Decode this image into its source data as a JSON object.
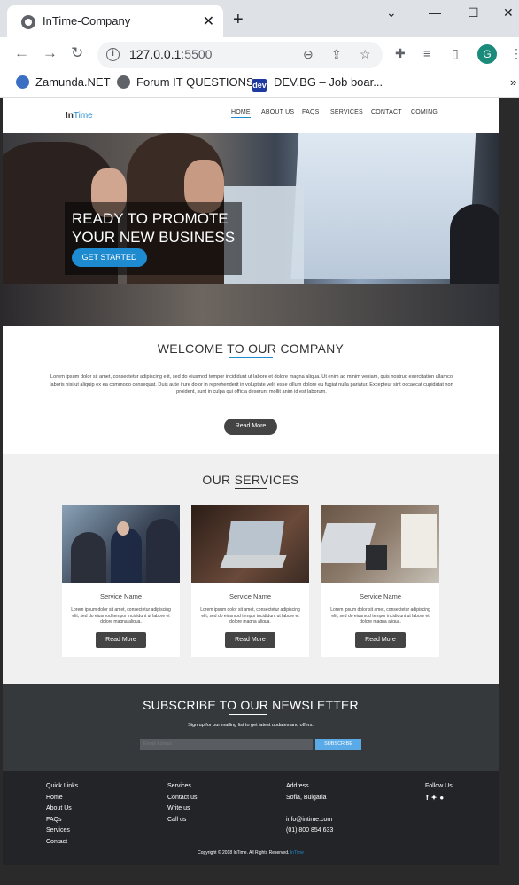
{
  "browser": {
    "tab_title": "InTime-Company",
    "url_host": "127.0.0.1",
    "url_port": ":5500",
    "profile_initial": "G",
    "bookmarks": [
      "Zamunda.NET",
      "Forum IT QUESTIONS",
      "DEV.BG – Job boar..."
    ],
    "dev_badge": "dev",
    "overflow": "»"
  },
  "site": {
    "logo_in": "In",
    "logo_time": "Time",
    "nav": [
      "HOME",
      "ABOUT US",
      "FAQS",
      "SERVICES",
      "CONTACT",
      "COMING"
    ],
    "hero": {
      "line1": "READY TO PROMOTE",
      "line2": "YOUR NEW BUSINESS",
      "button": "GET STARTED"
    },
    "welcome": {
      "title": "WELCOME TO OUR COMPANY",
      "text": "Lorem ipsum dolor sit amet, consectetur adipiscing elit, sed do eiusmod tempor incididunt ut labore et dolore magna aliqua. Ut enim ad minim veniam, quis nostrud exercitation ullamco laboris nisi ut aliquip ex ea commodo consequat. Duis aute irure dolor in reprehenderit in voluptate velit esse cillum dolore eu fugiat nulla pariatur. Excepteur sint occaecat cupidatat non proident, sunt in culpa qui officia deserunt mollit anim id est laborum.",
      "button": "Read More"
    },
    "services": {
      "title": "OUR SERVICES",
      "cards": [
        {
          "name": "Service Name",
          "text": "Lorem ipsum dolor sit amet, consectetur adipiscing elit, sed do eiusmod tempor incididunt ut labore et dolore magna aliqua.",
          "button": "Read More"
        },
        {
          "name": "Service Name",
          "text": "Lorem ipsum dolor sit amet, consectetur adipiscing elit, sed do eiusmod tempor incididunt ut labore et dolore magna aliqua.",
          "button": "Read More"
        },
        {
          "name": "Service Name",
          "text": "Lorem ipsum dolor sit amet, consectetur adipiscing elit, sed do eiusmod tempor incididunt ut labore et dolore magna aliqua.",
          "button": "Read More"
        }
      ]
    },
    "newsletter": {
      "title": "SUBSCRIBE TO OUR NEWSLETTER",
      "subtitle": "Sign up for our mailing list to get latest updates and offers.",
      "placeholder": "Email Adress",
      "button": "SUBSCRIBE"
    },
    "footer": {
      "quick_links_title": "Quick Links",
      "quick_links": [
        "Home",
        "About Us",
        "FAQs",
        "Services",
        "Contact"
      ],
      "services_title": "Services",
      "services": [
        "Contact us",
        "Write us",
        "Call us"
      ],
      "address_title": "Address",
      "address": "Sofia, Bulgaria",
      "email": "info@intime.com",
      "phone": "(01) 800 854 633",
      "follow_title": "Follow Us",
      "social_icons": [
        "facebook-icon",
        "twitter-icon",
        "github-icon"
      ],
      "copyright": "Copyright © 2018 InTime. All Rights Reserved.",
      "copyright_brand": "InTime"
    }
  },
  "colors": {
    "accent": "#1e8ad0",
    "dark": "#36393c",
    "footer": "#222427",
    "subscribe": "#5aaae8"
  }
}
